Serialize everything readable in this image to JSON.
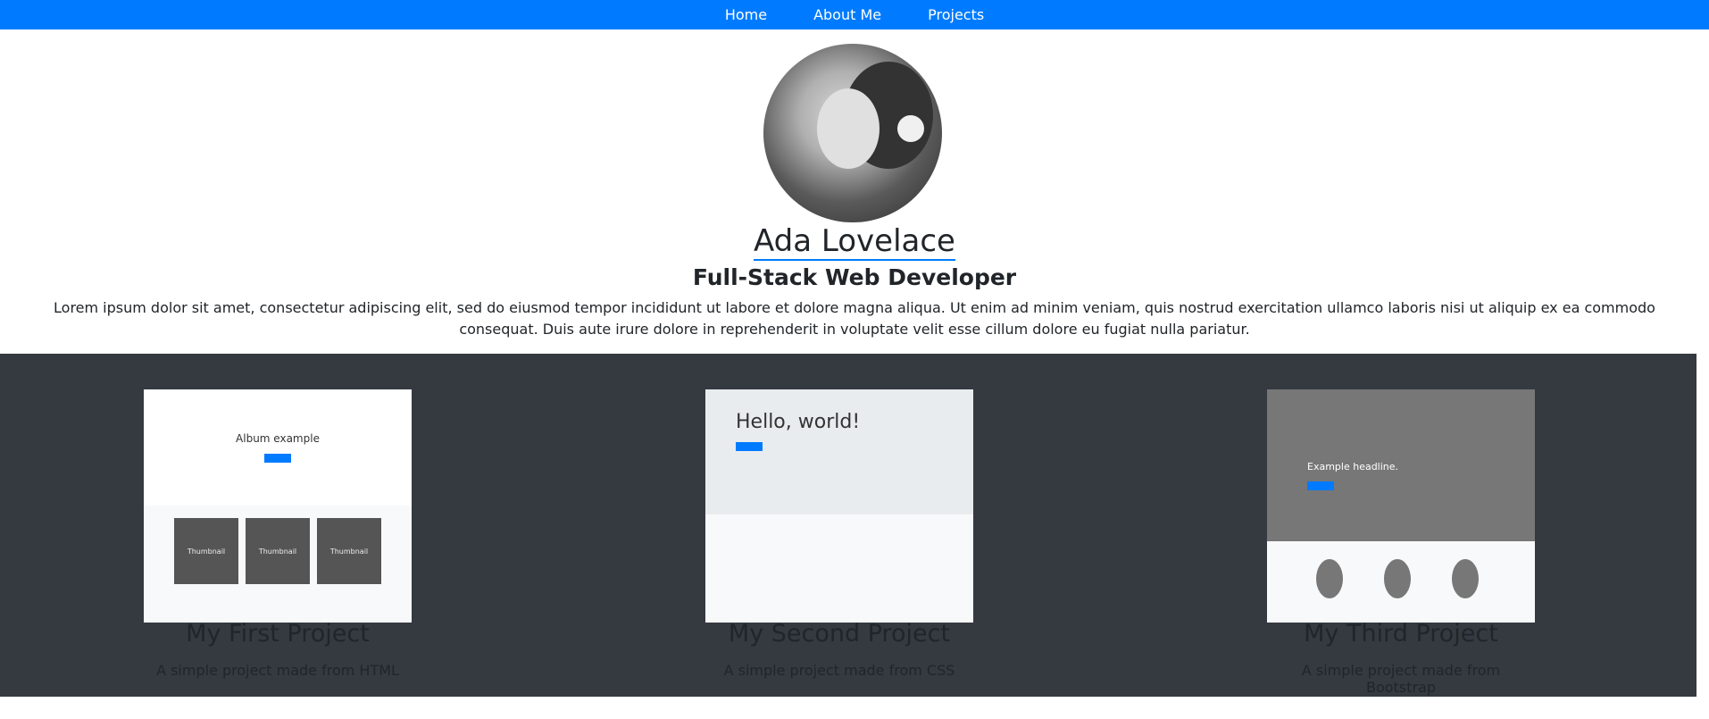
{
  "nav": {
    "items": [
      {
        "label": "Home"
      },
      {
        "label": "About Me"
      },
      {
        "label": "Projects"
      }
    ]
  },
  "profile": {
    "name": "Ada Lovelace",
    "role": "Full-Stack Web Developer",
    "bio": "Lorem ipsum dolor sit amet, consectetur adipiscing elit, sed do eiusmod tempor incididunt ut labore et dolore magna aliqua. Ut enim ad minim veniam, quis nostrud exercitation ullamco laboris nisi ut aliquip ex ea commodo consequat. Duis aute irure dolore in reprehenderit in voluptate velit esse cillum dolore eu fugiat nulla pariatur."
  },
  "projects": [
    {
      "title": "My First Project",
      "desc": "A simple project made from HTML",
      "thumb_heading": "Album example",
      "thumb_card": "Thumbnail"
    },
    {
      "title": "My Second Project",
      "desc": "A simple project made from CSS",
      "thumb_heading": "Hello, world!"
    },
    {
      "title": "My Third Project",
      "desc": "A simple project made from Bootstrap",
      "thumb_heading": "Example headline."
    }
  ],
  "colors": {
    "navbar": "#007bff",
    "projects_bg": "#343a40"
  }
}
